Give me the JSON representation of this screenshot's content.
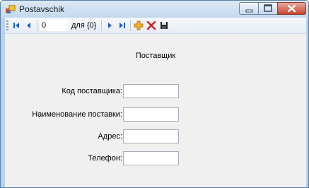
{
  "window": {
    "title": "Postavschik",
    "icons": [
      "app-icon",
      "minimize-icon",
      "maximize-icon",
      "close-icon"
    ]
  },
  "toolbar": {
    "position_value": "0",
    "count_label": "для {0}",
    "icons": [
      "move-first-icon",
      "move-previous-icon",
      "move-next-icon",
      "move-last-icon",
      "add-new-icon",
      "delete-icon",
      "save-icon"
    ]
  },
  "form": {
    "heading": "Поставщик",
    "fields": [
      {
        "label": "Код поставщика:",
        "value": ""
      },
      {
        "label": "Наименование поставки:",
        "value": ""
      },
      {
        "label": "Адрес:",
        "value": ""
      },
      {
        "label": "Телефон:",
        "value": ""
      }
    ]
  },
  "colors": {
    "titlebar": "#c4d8ee",
    "client_background": "#f0f0f0",
    "navigator_blue": "#1e5fbf",
    "add_orange": "#e8a020",
    "delete_red": "#d02020"
  }
}
